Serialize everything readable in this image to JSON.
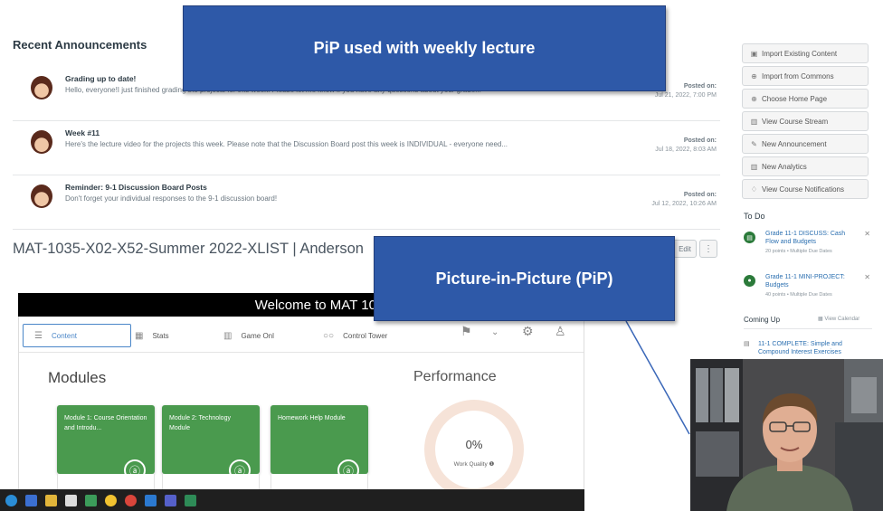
{
  "announcements": {
    "heading": "Recent Announcements",
    "items": [
      {
        "title": "Grading up to date!",
        "body": "Hello, everyone!I just finished grading the projects for this week. Please let me know if you have any questions about your grade...",
        "posted_label": "Posted on:",
        "date": "Jul 21, 2022, 7:00 PM"
      },
      {
        "title": "Week #11",
        "body": "Here's the lecture video for the projects this week. Please note that the Discussion Board post this week is INDIVIDUAL - everyone need...",
        "posted_label": "Posted on:",
        "date": "Jul 18, 2022, 8:03 AM"
      },
      {
        "title": "Reminder: 9-1 Discussion Board Posts",
        "body": "Don't forget your individual responses to the 9-1 discussion board!",
        "posted_label": "Posted on:",
        "date": "Jul 12, 2022, 10:26 AM"
      }
    ]
  },
  "course": {
    "title": "MAT-1035-X02-X52-Summer 2022-XLIST | Anderson",
    "edit_label": "Edit",
    "more_label": "⋮"
  },
  "embed": {
    "welcome": "Welcome to MAT 103",
    "tabs": [
      {
        "label": "Content",
        "icon": "☰"
      },
      {
        "label": "Stats",
        "icon": "▦"
      },
      {
        "label": "Game Onl",
        "icon": "▥"
      },
      {
        "label": "Control Tower",
        "icon": "○○"
      }
    ],
    "modules_heading": "Modules",
    "modules": [
      {
        "title": "Module 1: Course Orientation and Introdu..."
      },
      {
        "title": "Module 2: Technology Module"
      },
      {
        "title": "Homework Help Module"
      }
    ],
    "performance_heading": "Performance",
    "performance_value": "0%",
    "performance_label": "Work Quality ❶"
  },
  "sidebar": {
    "buttons": [
      {
        "icon": "▣",
        "label": "Import Existing Content"
      },
      {
        "icon": "⊕",
        "label": "Import from Commons"
      },
      {
        "icon": "⊕",
        "label": "Choose Home Page"
      },
      {
        "icon": "▥",
        "label": "View Course Stream"
      },
      {
        "icon": "✎",
        "label": "New Announcement"
      },
      {
        "icon": "▥",
        "label": "New Analytics"
      },
      {
        "icon": "♢",
        "label": "View Course Notifications"
      }
    ],
    "todo_heading": "To Do",
    "todo": [
      {
        "title": "Grade 11-1 DISCUSS: Cash Flow and Budgets",
        "meta": "20 points • Multiple Due Dates"
      },
      {
        "title": "Grade 11-1 MINI-PROJECT: Budgets",
        "meta": "40 points • Multiple Due Dates"
      }
    ],
    "coming_up_heading": "Coming Up",
    "view_calendar": "View Calendar",
    "coming_up": [
      {
        "title": "11-1 COMPLETE: Simple and Compound Interest Exercises"
      }
    ]
  },
  "callouts": {
    "top": "PiP used with weekly lecture",
    "pip": "Picture-in-Picture  (PiP)"
  },
  "colors": {
    "callout_blue": "#2e59a8",
    "module_green": "#4a9a4e",
    "link_blue": "#2b6fb0",
    "todo_green": "#2b7a3a"
  }
}
